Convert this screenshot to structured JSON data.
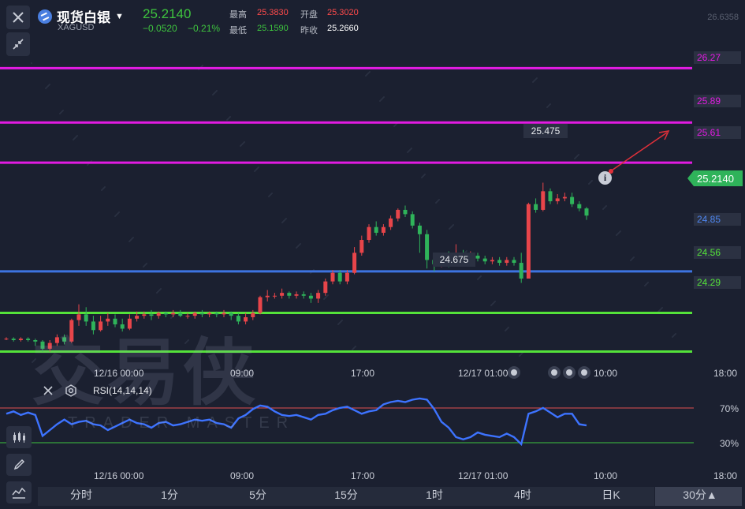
{
  "header": {
    "name": "现货白银",
    "symbol": "XAGUSD",
    "price": "25.2140",
    "change": "−0.0520",
    "change_pct": "−0.21%",
    "high_label": "最高",
    "high": "25.3830",
    "open_label": "开盘",
    "open": "25.3020",
    "low_label": "最低",
    "low": "25.1590",
    "prev_close_label": "昨收",
    "prev_close": "25.2660"
  },
  "axis": {
    "top_value": "26.6358",
    "current_price_tag": "25.2140"
  },
  "levels": [
    {
      "value": "26.27",
      "color": "#e21be2"
    },
    {
      "value": "25.89",
      "color": "#e21be2"
    },
    {
      "value": "25.61",
      "color": "#e21be2"
    },
    {
      "value": "24.85",
      "color": "#3d73e0"
    },
    {
      "value": "24.56",
      "color": "#54e23a"
    },
    {
      "value": "24.29",
      "color": "#54e23a"
    }
  ],
  "callouts": {
    "high_point": "25.475",
    "low_point": "24.675"
  },
  "xaxis": {
    "labels": [
      "12/16 00:00",
      "09:00",
      "17:00",
      "12/17 01:00",
      "10:00",
      "18:00"
    ]
  },
  "rsi": {
    "label": "RSI(14,14,14)",
    "upper_label": "70%",
    "lower_label": "30%",
    "upper_color": "#e05050",
    "lower_color": "#3ec43e",
    "line_color": "#3d73ff"
  },
  "watermark": {
    "cn": "交易侠",
    "en": "TRADER MASTER"
  },
  "timeframes": [
    "分时",
    "1分",
    "5分",
    "15分",
    "1时",
    "4时",
    "日K",
    "30分▲"
  ],
  "colors": {
    "up": "#e8454a",
    "down": "#2fb35a",
    "bg": "#1b2030"
  },
  "chart_data": {
    "type": "candlestick",
    "candles": [
      [
        24.38,
        24.38,
        24.37,
        24.39
      ],
      [
        24.38,
        24.37,
        24.36,
        24.39
      ],
      [
        24.37,
        24.38,
        24.36,
        24.39
      ],
      [
        24.38,
        24.37,
        24.36,
        24.39
      ],
      [
        24.37,
        24.36,
        24.33,
        24.38
      ],
      [
        24.36,
        24.31,
        24.29,
        24.37
      ],
      [
        24.31,
        24.35,
        24.29,
        24.37
      ],
      [
        24.35,
        24.39,
        24.33,
        24.41
      ],
      [
        24.39,
        24.36,
        24.34,
        24.41
      ],
      [
        24.36,
        24.51,
        24.35,
        24.52
      ],
      [
        24.51,
        24.55,
        24.47,
        24.62
      ],
      [
        24.55,
        24.5,
        24.47,
        24.6
      ],
      [
        24.5,
        24.44,
        24.41,
        24.54
      ],
      [
        24.44,
        24.5,
        24.43,
        24.54
      ],
      [
        24.5,
        24.52,
        24.47,
        24.56
      ],
      [
        24.52,
        24.48,
        24.46,
        24.55
      ],
      [
        24.48,
        24.45,
        24.43,
        24.52
      ],
      [
        24.45,
        24.52,
        24.44,
        24.55
      ],
      [
        24.52,
        24.54,
        24.5,
        24.57
      ],
      [
        24.54,
        24.55,
        24.52,
        24.57
      ],
      [
        24.55,
        24.54,
        24.51,
        24.58
      ],
      [
        24.54,
        24.56,
        24.52,
        24.57
      ],
      [
        24.56,
        24.55,
        24.53,
        24.57
      ],
      [
        24.55,
        24.56,
        24.53,
        24.58
      ],
      [
        24.56,
        24.54,
        24.53,
        24.58
      ],
      [
        24.54,
        24.54,
        24.52,
        24.56
      ],
      [
        24.54,
        24.56,
        24.52,
        24.57
      ],
      [
        24.56,
        24.55,
        24.53,
        24.58
      ],
      [
        24.55,
        24.56,
        24.53,
        24.57
      ],
      [
        24.56,
        24.55,
        24.53,
        24.57
      ],
      [
        24.55,
        24.56,
        24.53,
        24.58
      ],
      [
        24.56,
        24.54,
        24.51,
        24.57
      ],
      [
        24.54,
        24.5,
        24.48,
        24.56
      ],
      [
        24.5,
        24.53,
        24.48,
        24.56
      ],
      [
        24.53,
        24.56,
        24.51,
        24.58
      ],
      [
        24.56,
        24.67,
        24.55,
        24.68
      ],
      [
        24.67,
        24.68,
        24.64,
        24.72
      ],
      [
        24.68,
        24.68,
        24.66,
        24.7
      ],
      [
        24.68,
        24.7,
        24.66,
        24.73
      ],
      [
        24.7,
        24.68,
        24.66,
        24.71
      ],
      [
        24.68,
        24.69,
        24.66,
        24.71
      ],
      [
        24.69,
        24.68,
        24.66,
        24.71
      ],
      [
        24.68,
        24.66,
        24.63,
        24.7
      ],
      [
        24.66,
        24.7,
        24.63,
        24.72
      ],
      [
        24.7,
        24.78,
        24.68,
        24.8
      ],
      [
        24.78,
        24.84,
        24.76,
        24.86
      ],
      [
        24.84,
        24.78,
        24.76,
        24.86
      ],
      [
        24.78,
        24.84,
        24.76,
        24.86
      ],
      [
        24.84,
        24.98,
        24.83,
        25.02
      ],
      [
        24.98,
        25.07,
        24.96,
        25.1
      ],
      [
        25.07,
        25.16,
        25.05,
        25.18
      ],
      [
        25.16,
        25.12,
        25.1,
        25.2
      ],
      [
        25.12,
        25.16,
        25.1,
        25.18
      ],
      [
        25.16,
        25.22,
        25.14,
        25.24
      ],
      [
        25.22,
        25.28,
        25.2,
        25.29
      ],
      [
        25.28,
        25.25,
        25.23,
        25.31
      ],
      [
        25.25,
        25.17,
        25.15,
        25.27
      ],
      [
        25.17,
        25.11,
        24.98,
        25.19
      ],
      [
        25.11,
        24.93,
        24.87,
        25.14
      ],
      [
        24.93,
        24.9,
        24.85,
        24.98
      ],
      [
        24.9,
        24.96,
        24.88,
        24.98
      ],
      [
        24.96,
        24.93,
        24.88,
        24.99
      ],
      [
        24.93,
        24.98,
        24.91,
        25.04
      ],
      [
        24.98,
        24.94,
        24.9,
        25.0
      ],
      [
        24.94,
        24.96,
        24.91,
        24.99
      ],
      [
        24.96,
        24.94,
        24.92,
        24.98
      ],
      [
        24.94,
        24.92,
        24.9,
        24.96
      ],
      [
        24.92,
        24.93,
        24.9,
        24.95
      ],
      [
        24.93,
        24.91,
        24.89,
        24.95
      ],
      [
        24.91,
        24.93,
        24.89,
        24.95
      ],
      [
        24.93,
        24.91,
        24.89,
        24.95
      ],
      [
        24.91,
        24.8,
        24.77,
        24.98
      ],
      [
        24.8,
        25.32,
        24.8,
        25.33
      ],
      [
        25.32,
        25.28,
        25.26,
        25.36
      ],
      [
        25.28,
        25.41,
        25.27,
        25.47
      ],
      [
        25.41,
        25.34,
        25.32,
        25.43
      ],
      [
        25.34,
        25.36,
        25.32,
        25.39
      ],
      [
        25.36,
        25.37,
        25.34,
        25.4
      ],
      [
        25.37,
        25.32,
        25.3,
        25.4
      ],
      [
        25.32,
        25.29,
        25.27,
        25.34
      ],
      [
        25.29,
        25.24,
        25.21,
        25.3
      ]
    ],
    "rsi_values": [
      64,
      66,
      63,
      65,
      63,
      45,
      50,
      55,
      59,
      55,
      57,
      58,
      55,
      54,
      50,
      53,
      56,
      59,
      56,
      55,
      52,
      56,
      57,
      54,
      55,
      57,
      59,
      58,
      59,
      56,
      55,
      52,
      60,
      63,
      68,
      71,
      70,
      66,
      63,
      62,
      63,
      61,
      59,
      63,
      64,
      67,
      69,
      70,
      67,
      64,
      66,
      67,
      72,
      74,
      75,
      74,
      76,
      77,
      76,
      68,
      57,
      52,
      44,
      42,
      44,
      48,
      46,
      45,
      44,
      47,
      44,
      38,
      64,
      66,
      69,
      65,
      61,
      64,
      64,
      55,
      54
    ],
    "rsi_ylim": [
      0,
      100
    ],
    "ylim": [
      24.155,
      26.6358
    ]
  }
}
